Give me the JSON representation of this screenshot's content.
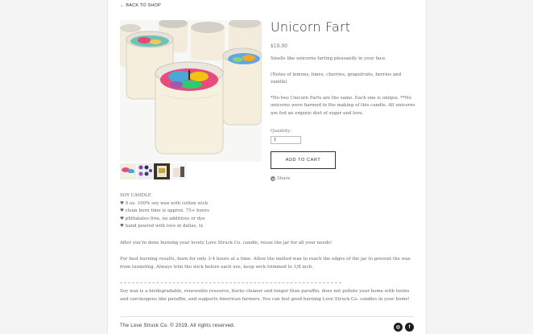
{
  "nav": {
    "back_label": "← BACK TO SHOP"
  },
  "product": {
    "title": "Unicorn Fart",
    "price": "$18.00",
    "description": [
      "Smells like unicorns farting pleasantly in your face.",
      "(Notes of lemons, limes, cherries, grapefruits, berries and vanilla)",
      "*No two Unicorn Farts are the same. Each one is unique. **No unicorns were harmed in the making of this candle. All unicorns are fed an organic diet of sugar and love."
    ],
    "quantity_label": "Quantity:",
    "quantity_value": "1",
    "add_to_cart_label": "ADD TO CART",
    "share_label": "Share"
  },
  "details": {
    "features": [
      "SOY CANDLE",
      "♥ 9 oz. 100% soy wax with cotton wick",
      "♥ clean burn time is approx. 75+ hours",
      "♥ phthalates free, no additives or dye",
      "♥ hand poured with love in dallas, tx"
    ],
    "reuse_note": "After you're done burning your lovely Love Struck Co. candle, reuse the jar for all your needs!",
    "burn_tip": "For best burning results, burn for only 3-4 hours at a time. Allow the melted wax to reach the edges of the jar to prevent the wax from tunneling.  Always trim the wick before each use, keep wick trimmed to 1/8 inch.",
    "soy_note": "Soy wax is a biodegradable, renewable resource, burns cleaner and longer than paraffin, does not pollute your home with toxins and carcinogens like paraffin, and supports American farmers. You can feel good burning Love Struck Co. candles in your home!"
  },
  "footer": {
    "copyright": "The Love Struck Co. © 2019. All rights reserved.",
    "social": [
      {
        "icon": "instagram-icon",
        "glyph": "◎"
      },
      {
        "icon": "facebook-icon",
        "glyph": "f"
      }
    ]
  }
}
